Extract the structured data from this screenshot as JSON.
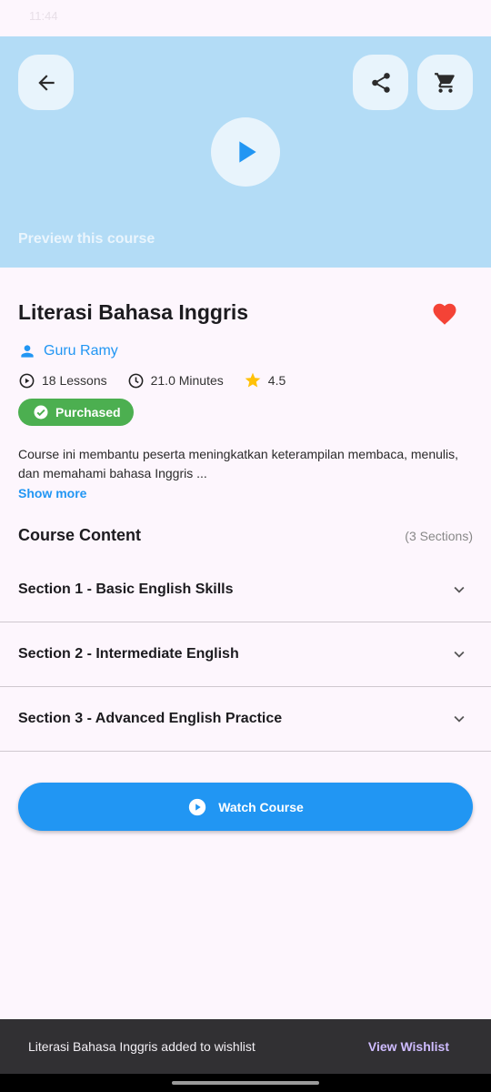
{
  "status_bar": {
    "left": "11:44",
    "right": ""
  },
  "hero": {
    "back_icon": "arrow-back-icon",
    "share_icon": "share-icon",
    "cart_icon": "shopping-cart-icon",
    "play_icon": "play-icon",
    "preview_label": "Preview this course"
  },
  "course": {
    "title": "Literasi Bahasa Inggris",
    "favorite": true,
    "instructor": "Guru Ramy",
    "lessons": "18 Lessons",
    "duration": "21.0 Minutes",
    "rating": "4.5",
    "purchased_label": "Purchased",
    "description": "Course ini membantu peserta meningkatkan keterampilan membaca, menulis, dan memahami bahasa Inggris ...",
    "show_more": "Show more"
  },
  "content": {
    "heading": "Course Content",
    "sections_count": "(3 Sections)",
    "sections": [
      {
        "title": "Section 1 - Basic English Skills"
      },
      {
        "title": "Section 2 - Intermediate English"
      },
      {
        "title": "Section 3 - Advanced English Practice"
      }
    ]
  },
  "actions": {
    "watch_label": "Watch Course"
  },
  "snackbar": {
    "message": "Literasi Bahasa Inggris added to wishlist",
    "action": "View Wishlist"
  },
  "colors": {
    "accent": "#2196f3",
    "hero_bg": "#b3dcf6",
    "purchased": "#4caf50",
    "heart": "#f44336",
    "star": "#ffc107",
    "snackbar_bg": "#313033",
    "snackbar_action": "#cfbcff"
  }
}
